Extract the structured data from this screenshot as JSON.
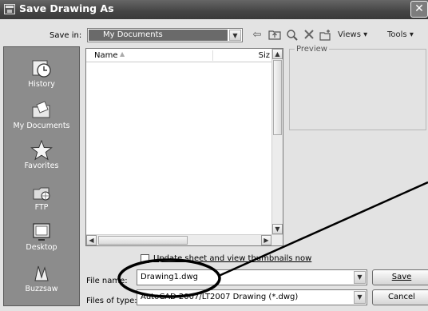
{
  "dialog": {
    "title": "Save Drawing As",
    "close_glyph": "✕"
  },
  "toolbar": {
    "save_in_label": "Save in:",
    "save_in_value": "My Documents",
    "views_label": "Views",
    "tools_label": "Tools",
    "icons": [
      "back-icon",
      "up-folder-icon",
      "search-web-icon",
      "delete-icon",
      "create-folder-icon"
    ]
  },
  "places": [
    {
      "label": "History",
      "icon": "history-icon"
    },
    {
      "label": "My Documents",
      "icon": "my-documents-icon"
    },
    {
      "label": "Favorites",
      "icon": "favorites-icon"
    },
    {
      "label": "FTP",
      "icon": "ftp-icon"
    },
    {
      "label": "Desktop",
      "icon": "desktop-icon"
    },
    {
      "label": "Buzzsaw",
      "icon": "buzzsaw-icon"
    }
  ],
  "file_list": {
    "columns": [
      "Name",
      "Siz"
    ]
  },
  "preview": {
    "title": "Preview"
  },
  "options": {
    "thumbnail_checkbox_label": "Update sheet and view thumbnails now",
    "thumbnail_checked": false
  },
  "file_name": {
    "label": "File name:",
    "value": "Drawing1.dwg"
  },
  "file_type": {
    "label": "Files of type:",
    "value": "AutoCAD 2007/LT2007 Drawing (*.dwg)"
  },
  "buttons": {
    "save": "Save",
    "cancel": "Cancel"
  },
  "colors": {
    "places_bar": "#8c8c8c",
    "title_bar": "#4a4a4a",
    "selection": "#6a6a6a"
  }
}
